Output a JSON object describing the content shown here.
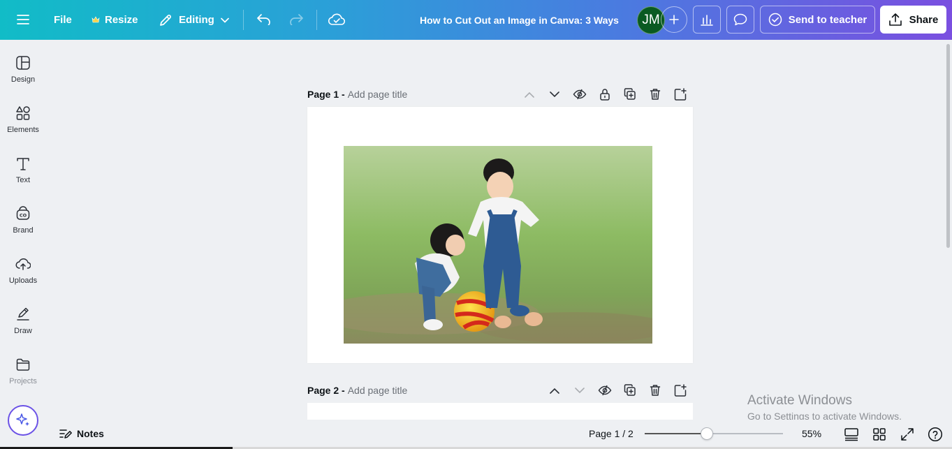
{
  "topbar": {
    "file_label": "File",
    "resize_label": "Resize",
    "editing_label": "Editing",
    "doc_title": "How to Cut Out an Image in Canva: 3 Ways",
    "avatar_initials": "JM",
    "send_teacher_label": "Send to teacher",
    "share_label": "Share",
    "avatar_color": "#0a5a22"
  },
  "sidebar": {
    "items": [
      {
        "label": "Design",
        "icon": "layout-icon"
      },
      {
        "label": "Elements",
        "icon": "shapes-icon"
      },
      {
        "label": "Text",
        "icon": "text-icon"
      },
      {
        "label": "Brand",
        "icon": "brand-icon"
      },
      {
        "label": "Uploads",
        "icon": "cloud-upload-icon"
      },
      {
        "label": "Draw",
        "icon": "pen-icon"
      },
      {
        "label": "Projects",
        "icon": "folder-icon"
      }
    ]
  },
  "pages": [
    {
      "number_label": "Page 1 -",
      "title_placeholder": "Add page title"
    },
    {
      "number_label": "Page 2 -",
      "title_placeholder": "Add page title"
    }
  ],
  "bottombar": {
    "notes_label": "Notes",
    "page_indicator": "Page 1 / 2",
    "zoom": "55%",
    "zoom_fraction": 0.45
  },
  "watermark": {
    "line1": "Activate Windows",
    "line2": "Go to Settings to activate Windows."
  }
}
